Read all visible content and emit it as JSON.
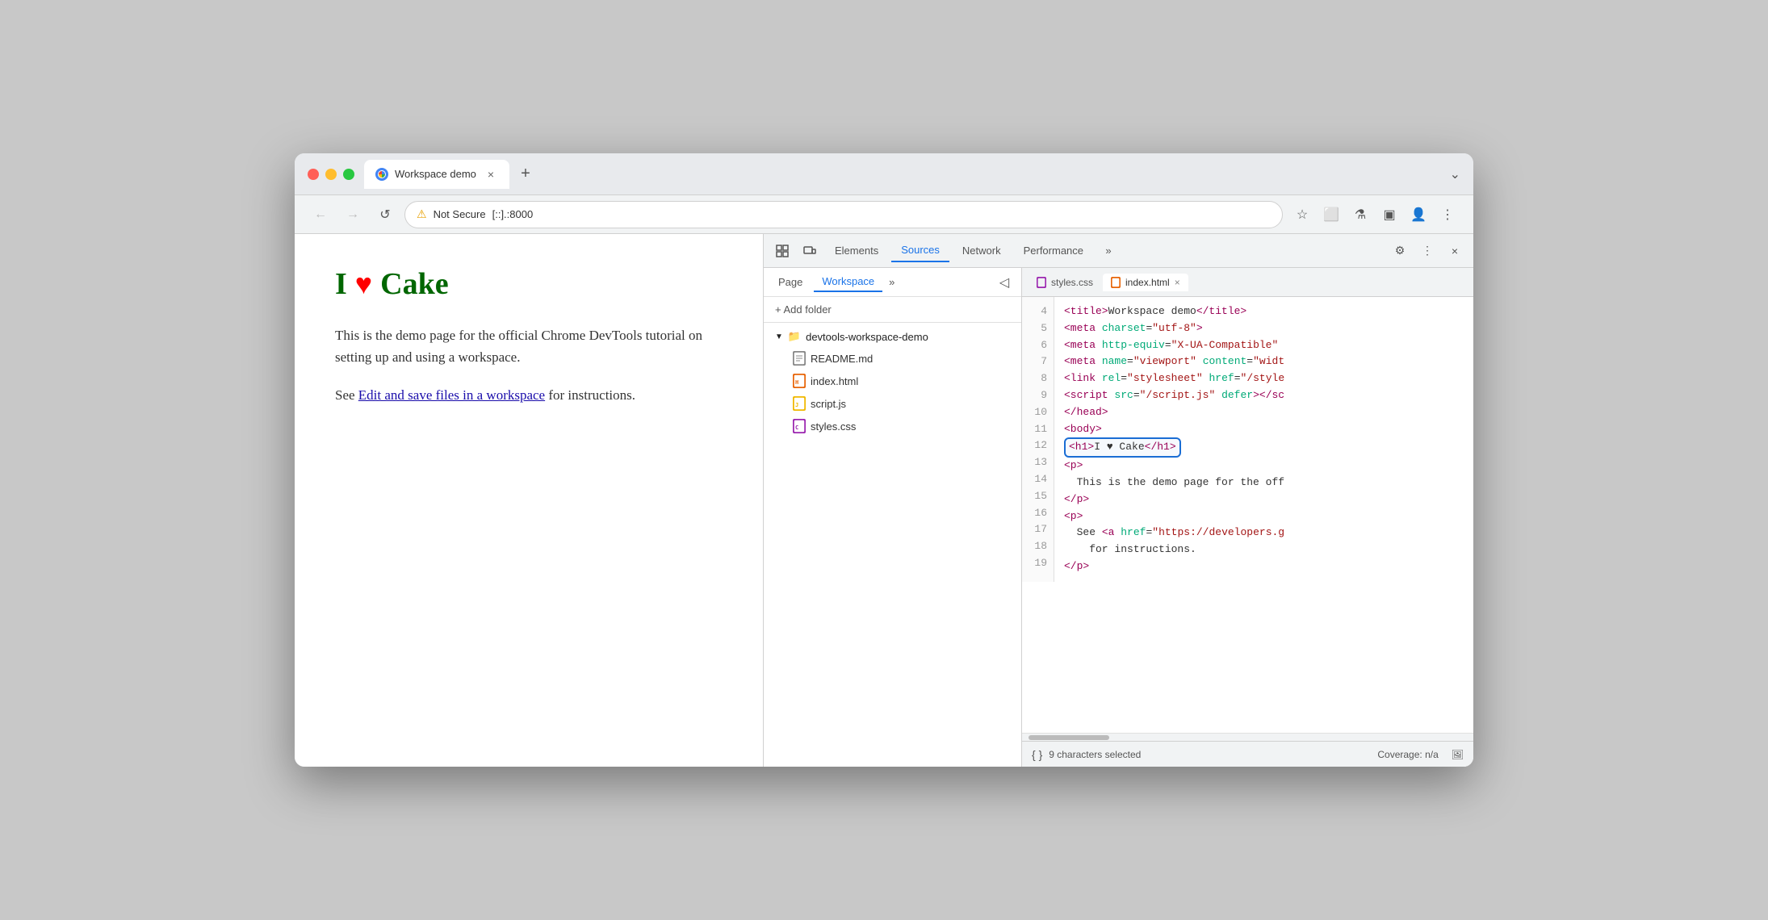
{
  "browser": {
    "tab_title": "Workspace demo",
    "tab_close": "×",
    "tab_new": "+",
    "chevron": "⌄",
    "back_btn": "←",
    "forward_btn": "→",
    "reload_btn": "↺",
    "address_warning": "⚠",
    "address_not_secure": "Not Secure",
    "address_url": "[::].:8000",
    "star_icon": "☆",
    "extension_icon": "⬜",
    "experiment_icon": "⚗",
    "sidebar_icon": "▣",
    "profile_icon": "👤",
    "more_icon": "⋮"
  },
  "page": {
    "heading_green": "I",
    "heading_heart": "♥",
    "heading_cake": "Cake",
    "paragraph1": "This is the demo page for the official Chrome DevTools tutorial on setting up and using a workspace.",
    "paragraph2_before": "See ",
    "paragraph2_link": "Edit and save files in a workspace",
    "paragraph2_after": " for instructions."
  },
  "devtools": {
    "tabs": [
      {
        "id": "inspector",
        "label": "⊞"
      },
      {
        "id": "responsive",
        "label": "⊡"
      },
      {
        "id": "elements",
        "label": "Elements"
      },
      {
        "id": "sources",
        "label": "Sources",
        "active": true
      },
      {
        "id": "network",
        "label": "Network"
      },
      {
        "id": "performance",
        "label": "Performance"
      },
      {
        "id": "more",
        "label": "»"
      }
    ],
    "gear_label": "⚙",
    "dots_label": "⋮",
    "close_label": "×"
  },
  "sources": {
    "tabs": [
      {
        "id": "page",
        "label": "Page"
      },
      {
        "id": "workspace",
        "label": "Workspace",
        "active": true
      }
    ],
    "more_label": "»",
    "hide_panel": "◁",
    "add_folder_label": "+ Add folder",
    "folder": {
      "name": "devtools-workspace-demo",
      "files": [
        {
          "id": "readme",
          "name": "README.md",
          "type": "md"
        },
        {
          "id": "index",
          "name": "index.html",
          "type": "html"
        },
        {
          "id": "script",
          "name": "script.js",
          "type": "js"
        },
        {
          "id": "styles",
          "name": "styles.css",
          "type": "css"
        }
      ]
    }
  },
  "code_tabs": [
    {
      "id": "styles",
      "name": "styles.css",
      "icon": "css",
      "active": false
    },
    {
      "id": "index",
      "name": "index.html",
      "icon": "html",
      "active": true,
      "closeable": true
    }
  ],
  "code_lines": [
    {
      "num": 4,
      "content": "    <title>Workspace demo</title>",
      "highlight": false
    },
    {
      "num": 5,
      "content": "    <meta charset=\"utf-8\">",
      "highlight": false
    },
    {
      "num": 6,
      "content": "    <meta http-equiv=\"X-UA-Compatible\"",
      "highlight": false
    },
    {
      "num": 7,
      "content": "    <meta name=\"viewport\" content=\"widt",
      "highlight": false
    },
    {
      "num": 8,
      "content": "    <link rel=\"stylesheet\" href=\"/style",
      "highlight": false
    },
    {
      "num": 9,
      "content": "    <script src=\"/script.js\" defer></sc",
      "highlight": false
    },
    {
      "num": 10,
      "content": "  </head>",
      "highlight": false
    },
    {
      "num": 11,
      "content": "  <body>",
      "highlight": false
    },
    {
      "num": 12,
      "content": "    <h1>I ♥ Cake</h1>",
      "highlight": true,
      "boxed": true
    },
    {
      "num": 13,
      "content": "    <p>",
      "highlight": false
    },
    {
      "num": 14,
      "content": "      This is the demo page for the off",
      "highlight": false
    },
    {
      "num": 15,
      "content": "    </p>",
      "highlight": false
    },
    {
      "num": 16,
      "content": "    <p>",
      "highlight": false
    },
    {
      "num": 17,
      "content": "      See <a href=\"https://developers.g",
      "highlight": false
    },
    {
      "num": 18,
      "content": "        for instructions.",
      "highlight": false
    },
    {
      "num": 19,
      "content": "    </p>",
      "highlight": false
    }
  ],
  "status": {
    "curly": "{ }",
    "chars_selected": "9 characters selected",
    "coverage": "Coverage: n/a",
    "screenshot_icon": "🖼"
  }
}
